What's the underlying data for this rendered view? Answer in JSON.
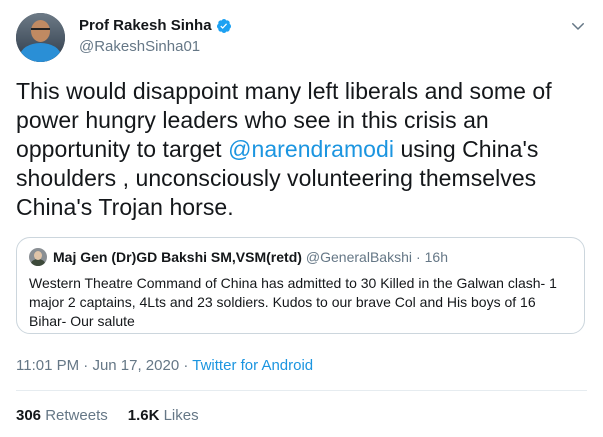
{
  "author": {
    "name": "Prof Rakesh Sinha",
    "handle": "@RakeshSinha01"
  },
  "tweet": {
    "text_part1": "This would disappoint many left liberals and some of power hungry  leaders who see in this crisis an opportunity to target ",
    "mention": "@narendramodi",
    "text_part2": " using China's shoulders , unconsciously volunteering themselves China's Trojan horse."
  },
  "quoted": {
    "name": "Maj Gen (Dr)GD Bakshi SM,VSM(retd)",
    "handle": "@GeneralBakshi",
    "separator": "·",
    "time": "16h",
    "text": "Western Theatre Command of China has admitted  to 30 Killed in the Galwan clash- 1 major 2 captains, 4Lts and 23 soldiers. Kudos to our brave Col and His boys of 16 Bihar- Our salute"
  },
  "meta": {
    "time": "11:01 PM",
    "separator1": "·",
    "date": "Jun 17, 2020",
    "separator2": "·",
    "source": "Twitter for Android"
  },
  "stats": {
    "retweets_count": "306",
    "retweets_label": "Retweets",
    "likes_count": "1.6K",
    "likes_label": "Likes"
  },
  "colors": {
    "link": "#1b95e0",
    "secondary_text": "#657786",
    "border": "#ccd6dd"
  }
}
